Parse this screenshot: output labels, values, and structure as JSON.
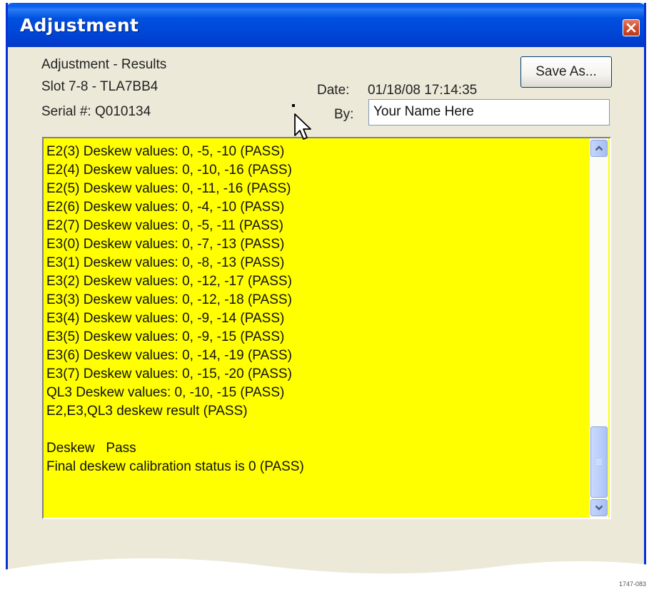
{
  "window": {
    "title": "Adjustment",
    "close_icon": "close-icon"
  },
  "header": {
    "title_line": "Adjustment - Results",
    "slot_line": "Slot 7-8 - TLA7BB4",
    "serial_line": "Serial #: Q010134",
    "date_label": "Date:",
    "date_value": "01/18/08 17:14:35",
    "by_label": "By:",
    "by_value": "Your Name Here",
    "save_as_label": "Save As..."
  },
  "log": {
    "background_color": "#ffff00",
    "lines": [
      "E2(3) Deskew values: 0, -5, -10 (PASS)",
      "E2(4) Deskew values: 0, -10, -16 (PASS)",
      "E2(5) Deskew values: 0, -11, -16 (PASS)",
      "E2(6) Deskew values: 0, -4, -10 (PASS)",
      "E2(7) Deskew values: 0, -5, -11 (PASS)",
      "E3(0) Deskew values: 0, -7, -13 (PASS)",
      "E3(1) Deskew values: 0, -8, -13 (PASS)",
      "E3(2) Deskew values: 0, -12, -17 (PASS)",
      "E3(3) Deskew values: 0, -12, -18 (PASS)",
      "E3(4) Deskew values: 0, -9, -14 (PASS)",
      "E3(5) Deskew values: 0, -9, -15 (PASS)",
      "E3(6) Deskew values: 0, -14, -19 (PASS)",
      "E3(7) Deskew values: 0, -15, -20 (PASS)",
      "QL3 Deskew values: 0, -10, -15 (PASS)",
      "E2,E3,QL3 deskew result (PASS)",
      "",
      "Deskew   Pass",
      "Final deskew calibration status is 0 (PASS)"
    ],
    "scrollbar": {
      "up_icon": "chevron-up-icon",
      "down_icon": "chevron-down-icon",
      "scroll_position": "bottom"
    }
  },
  "figure_code": "1747-083"
}
